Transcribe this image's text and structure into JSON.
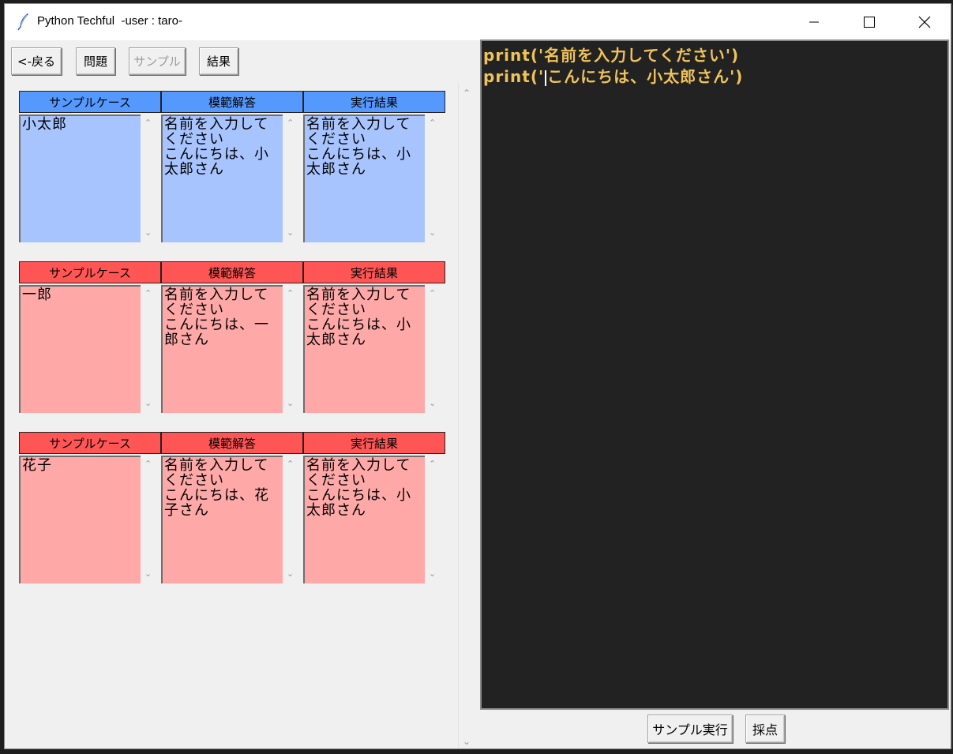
{
  "window": {
    "title": "Python Techful  -user : taro-"
  },
  "toolbar": {
    "back_label": "<-戻る",
    "problem_label": "問題",
    "sample_label": "サンプル",
    "result_label": "結果"
  },
  "headers": {
    "sample_case": "サンプルケース",
    "model_answer": "模範解答",
    "exec_result": "実行結果"
  },
  "cases": [
    {
      "status": "pass",
      "input": "小太郎",
      "expected": "名前を入力してください\nこんにちは、小太郎さん",
      "actual": "名前を入力してください\nこんにちは、小太郎さん"
    },
    {
      "status": "fail",
      "input": "一郎",
      "expected": "名前を入力してください\nこんにちは、一郎さん",
      "actual": "名前を入力してください\nこんにちは、小太郎さん"
    },
    {
      "status": "fail",
      "input": "花子",
      "expected": "名前を入力してください\nこんにちは、花子さん",
      "actual": "名前を入力してください\nこんにちは、小太郎さん"
    }
  ],
  "editor": {
    "line1": "print('名前を入力してください')",
    "line2_before_cursor": "print('",
    "line2_after_cursor": "こんにちは、小太郎さん')"
  },
  "bottom": {
    "run_sample_label": "サンプル実行",
    "grade_label": "採点"
  },
  "colors": {
    "pass_header": "#5599ff",
    "pass_cell": "#a8c4ff",
    "fail_header": "#ff5555",
    "fail_cell": "#ffa8a8",
    "editor_bg": "#222222",
    "code_text": "#f0c35a"
  }
}
